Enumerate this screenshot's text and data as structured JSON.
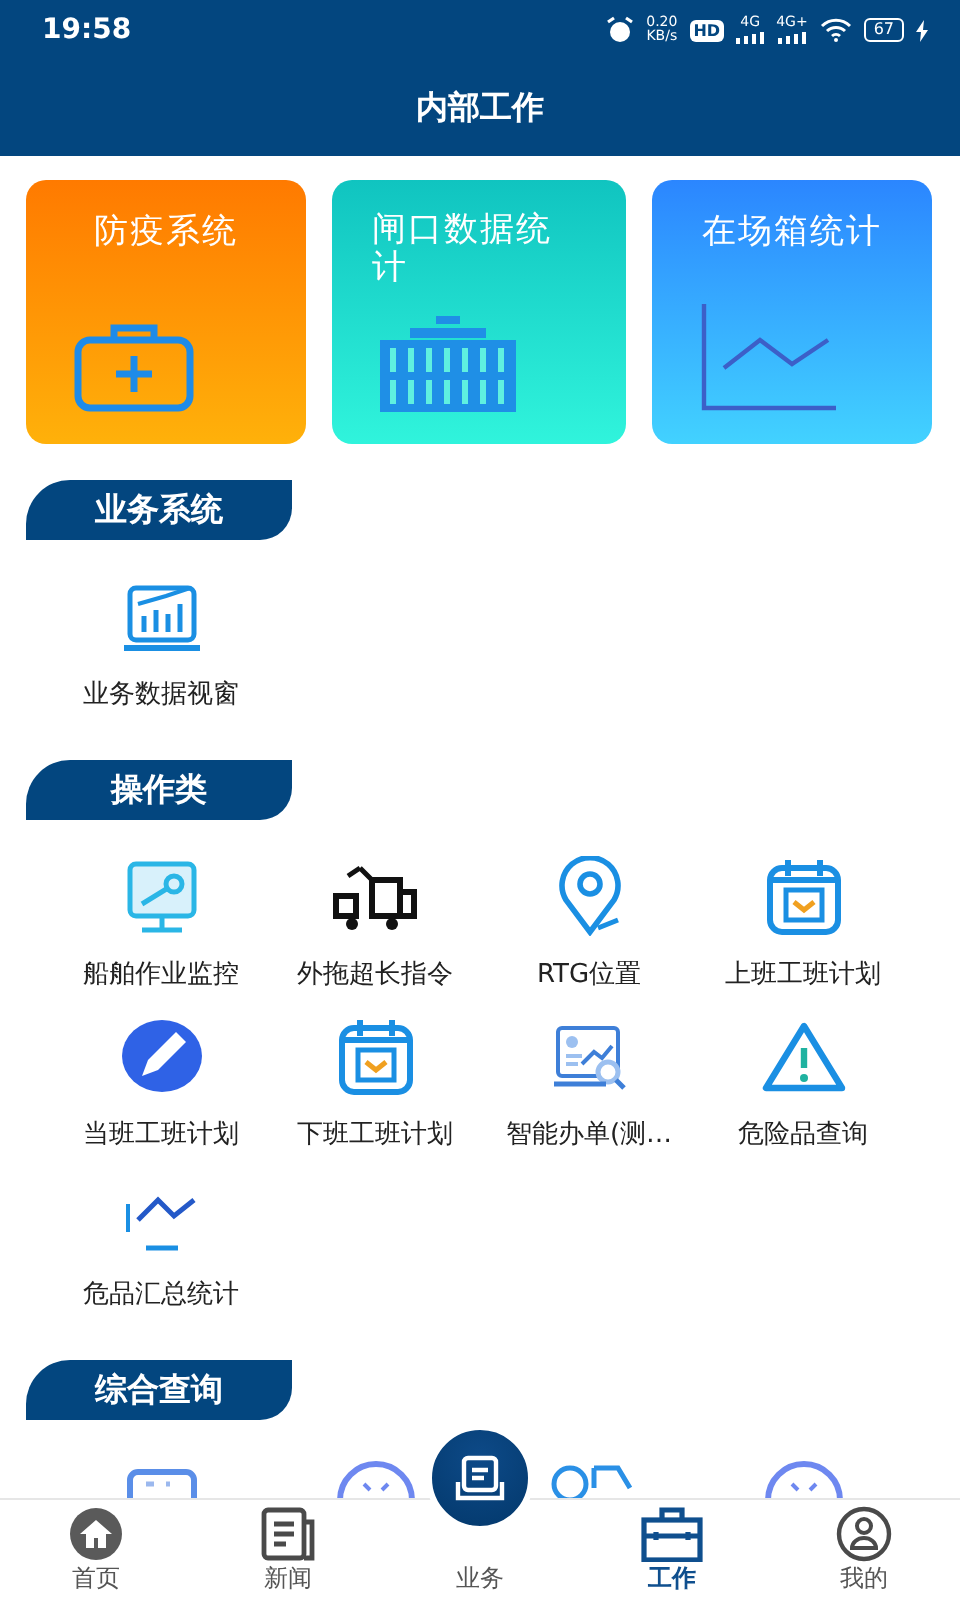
{
  "status_bar": {
    "time": "19:58",
    "speed_value": "0.20",
    "speed_unit": "KB/s",
    "hd": "HD",
    "networks": [
      "4G",
      "4G+"
    ],
    "battery": "67"
  },
  "header": {
    "title": "内部工作"
  },
  "cards": [
    {
      "title": "防疫系统",
      "kind": "medkit"
    },
    {
      "title": "闸口数据统计",
      "kind": "container"
    },
    {
      "title": "在场箱统计",
      "kind": "chart"
    }
  ],
  "sections": [
    {
      "title": "业务系统",
      "items": [
        {
          "label": "业务数据视窗",
          "kind": "monitor-chart"
        }
      ]
    },
    {
      "title": "操作类",
      "items": [
        {
          "label": "船舶作业监控",
          "kind": "monitor-map"
        },
        {
          "label": "外拖超长指令",
          "kind": "truck"
        },
        {
          "label": "RTG位置",
          "kind": "pin"
        },
        {
          "label": "上班工班计划",
          "kind": "calendar"
        },
        {
          "label": "当班工班计划",
          "kind": "pencil"
        },
        {
          "label": "下班工班计划",
          "kind": "calendar"
        },
        {
          "label": "智能办单(测…",
          "kind": "report"
        },
        {
          "label": "危险品查询",
          "kind": "warning"
        },
        {
          "label": "危品汇总统计",
          "kind": "wave"
        }
      ]
    },
    {
      "title": "综合查询",
      "items": [
        {
          "kind": "card"
        },
        {
          "kind": "dome"
        },
        {
          "kind": "file"
        },
        {
          "kind": "dome"
        }
      ]
    }
  ],
  "tabs": [
    {
      "label": "首页",
      "kind": "home",
      "selected": false
    },
    {
      "label": "新闻",
      "kind": "news",
      "selected": false
    },
    {
      "label": "业务",
      "kind": "center",
      "selected": false
    },
    {
      "label": "工作",
      "kind": "briefcase",
      "selected": true
    },
    {
      "label": "我的",
      "kind": "person",
      "selected": false
    }
  ]
}
